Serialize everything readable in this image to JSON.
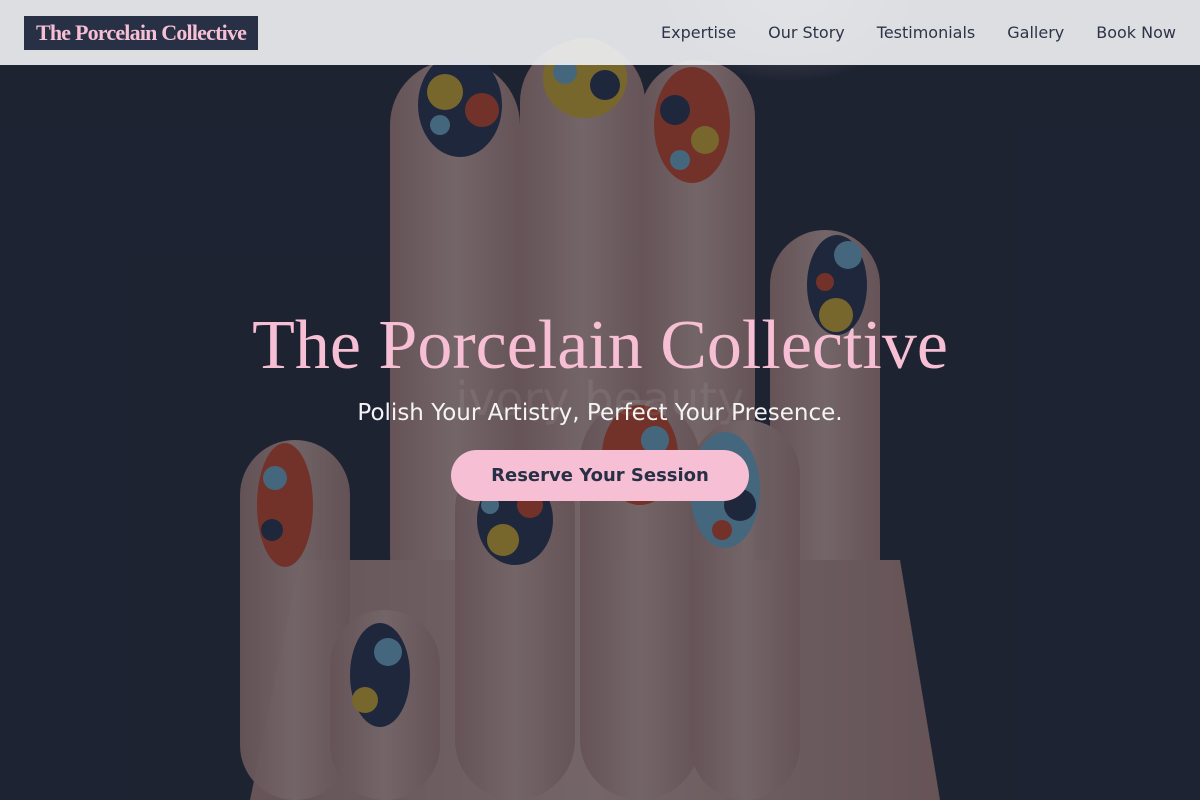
{
  "header": {
    "logo": "The Porcelain Collective",
    "nav": [
      {
        "label": "Expertise"
      },
      {
        "label": "Our Story"
      },
      {
        "label": "Testimonials"
      },
      {
        "label": "Gallery"
      },
      {
        "label": "Book Now"
      }
    ]
  },
  "hero": {
    "title": "The Porcelain Collective",
    "subtitle": "Polish Your Artistry, Perfect Your Presence.",
    "cta": "Reserve Your Session",
    "watermark": "ivory beauty",
    "image": "hand-with-abstract-nail-art"
  },
  "colors": {
    "accent": "#f6bfd4",
    "navy": "#283046",
    "header_bg": "#ecedf0"
  }
}
